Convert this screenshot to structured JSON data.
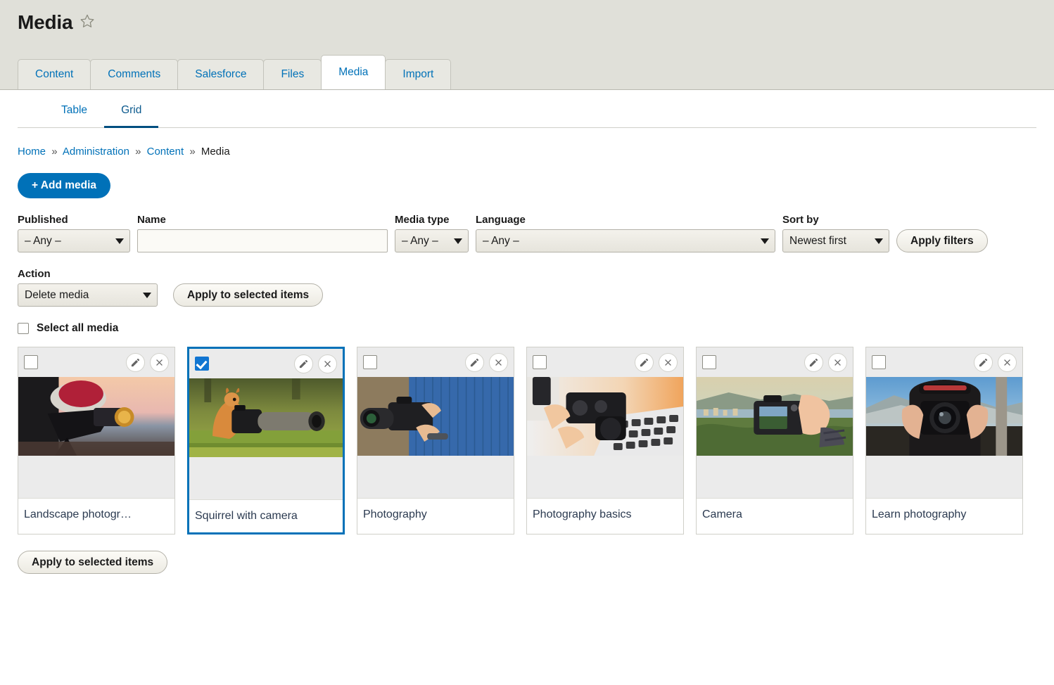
{
  "header": {
    "title": "Media",
    "favorite_icon": "star-outline-icon"
  },
  "primary_tabs": [
    {
      "label": "Content",
      "active": false
    },
    {
      "label": "Comments",
      "active": false
    },
    {
      "label": "Salesforce",
      "active": false
    },
    {
      "label": "Files",
      "active": false
    },
    {
      "label": "Media",
      "active": true
    },
    {
      "label": "Import",
      "active": false
    }
  ],
  "secondary_tabs": [
    {
      "label": "Table",
      "active": false
    },
    {
      "label": "Grid",
      "active": true
    }
  ],
  "breadcrumb": {
    "items": [
      "Home",
      "Administration",
      "Content",
      "Media"
    ],
    "separator": "»"
  },
  "actions": {
    "add_media_label": "+ Add media"
  },
  "filters": {
    "published": {
      "label": "Published",
      "value": "– Any –"
    },
    "name": {
      "label": "Name",
      "value": "",
      "placeholder": ""
    },
    "media_type": {
      "label": "Media type",
      "value": "– Any –"
    },
    "language": {
      "label": "Language",
      "value": "– Any –"
    },
    "sort_by": {
      "label": "Sort by",
      "value": "Newest first"
    },
    "apply_label": "Apply filters"
  },
  "bulk": {
    "action_label": "Action",
    "action_value": "Delete media",
    "apply_label": "Apply to selected items",
    "select_all_label": "Select all media"
  },
  "footer": {
    "apply_label": "Apply to selected items"
  },
  "card_icons": {
    "edit": "pencil-icon",
    "delete": "close-x-icon"
  },
  "media_items": [
    {
      "title": "Landscape photogr…",
      "selected": false,
      "thumb": "photographer-red-hat"
    },
    {
      "title": "Squirrel with camera",
      "selected": true,
      "thumb": "squirrel-camera"
    },
    {
      "title": "Photography",
      "selected": false,
      "thumb": "blue-shirt-camera"
    },
    {
      "title": "Photography basics",
      "selected": false,
      "thumb": "camera-laptop"
    },
    {
      "title": "Camera",
      "selected": false,
      "thumb": "camera-lake-view"
    },
    {
      "title": "Learn photography",
      "selected": false,
      "thumb": "photographer-mountain"
    }
  ],
  "colors": {
    "accent": "#0071b8",
    "selected_border": "#0071b8",
    "header_bg": "#e0e0d9",
    "checkbox_checked": "#1175d1"
  }
}
